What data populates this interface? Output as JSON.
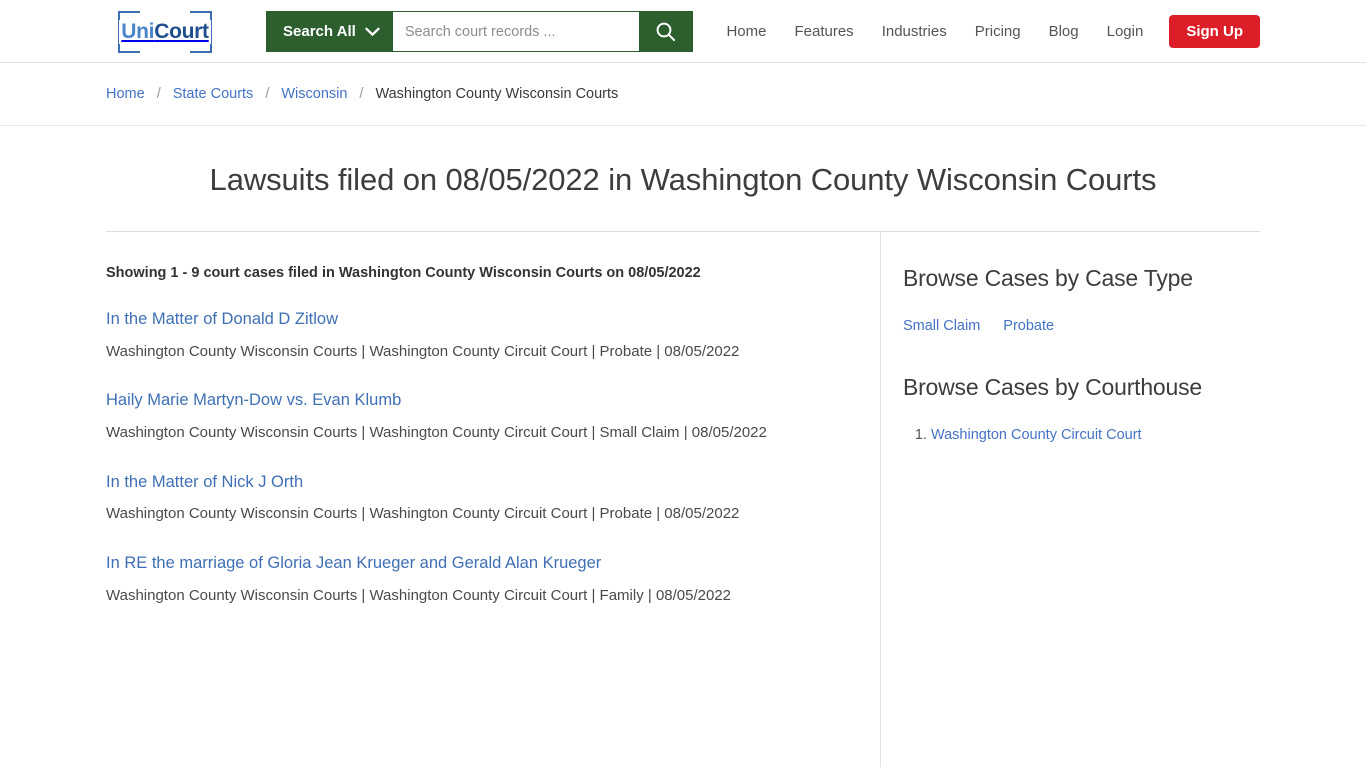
{
  "header": {
    "logo": {
      "part1": "Uni",
      "part2": "Court"
    },
    "search": {
      "scope_label": "Search All",
      "placeholder": "Search court records ...",
      "value": "",
      "search_icon": "search-icon",
      "chevron_icon": "chevron-down-icon"
    },
    "nav": [
      {
        "label": "Home"
      },
      {
        "label": "Features"
      },
      {
        "label": "Industries"
      },
      {
        "label": "Pricing"
      },
      {
        "label": "Blog"
      },
      {
        "label": "Login"
      }
    ],
    "signup_label": "Sign Up"
  },
  "breadcrumb": {
    "items": [
      {
        "label": "Home",
        "link": true
      },
      {
        "label": "State Courts",
        "link": true
      },
      {
        "label": "Wisconsin",
        "link": true
      },
      {
        "label": "Washington County Wisconsin Courts",
        "link": false
      }
    ],
    "separator": "/"
  },
  "main": {
    "title": "Lawsuits filed on 08/05/2022 in Washington County Wisconsin Courts",
    "showing": "Showing 1 - 9 court cases filed in Washington County Wisconsin Courts on 08/05/2022",
    "cases": [
      {
        "title": "In the Matter of Donald D Zitlow",
        "meta": "Washington County Wisconsin Courts | Washington County Circuit Court | Probate | 08/05/2022"
      },
      {
        "title": "Haily Marie Martyn-Dow vs. Evan Klumb",
        "meta": "Washington County Wisconsin Courts | Washington County Circuit Court | Small Claim | 08/05/2022"
      },
      {
        "title": "In the Matter of Nick J Orth",
        "meta": "Washington County Wisconsin Courts | Washington County Circuit Court | Probate | 08/05/2022"
      },
      {
        "title": "In RE the marriage of Gloria Jean Krueger and Gerald Alan Krueger",
        "meta": "Washington County Wisconsin Courts | Washington County Circuit Court | Family | 08/05/2022"
      }
    ]
  },
  "sidebar": {
    "case_type_heading": "Browse Cases by Case Type",
    "case_types": [
      {
        "label": "Small Claim"
      },
      {
        "label": "Probate"
      }
    ],
    "courthouse_heading": "Browse Cases by Courthouse",
    "courthouses": [
      {
        "label": "Washington County Circuit Court"
      }
    ]
  },
  "colors": {
    "brand_green": "#2c5e2e",
    "link_blue": "#4472c4",
    "case_link_blue": "#3f6fb5",
    "signup_red": "#dc1e28",
    "logo_blue_light": "#4a85c9",
    "logo_blue_dark": "#1f4e8c"
  }
}
